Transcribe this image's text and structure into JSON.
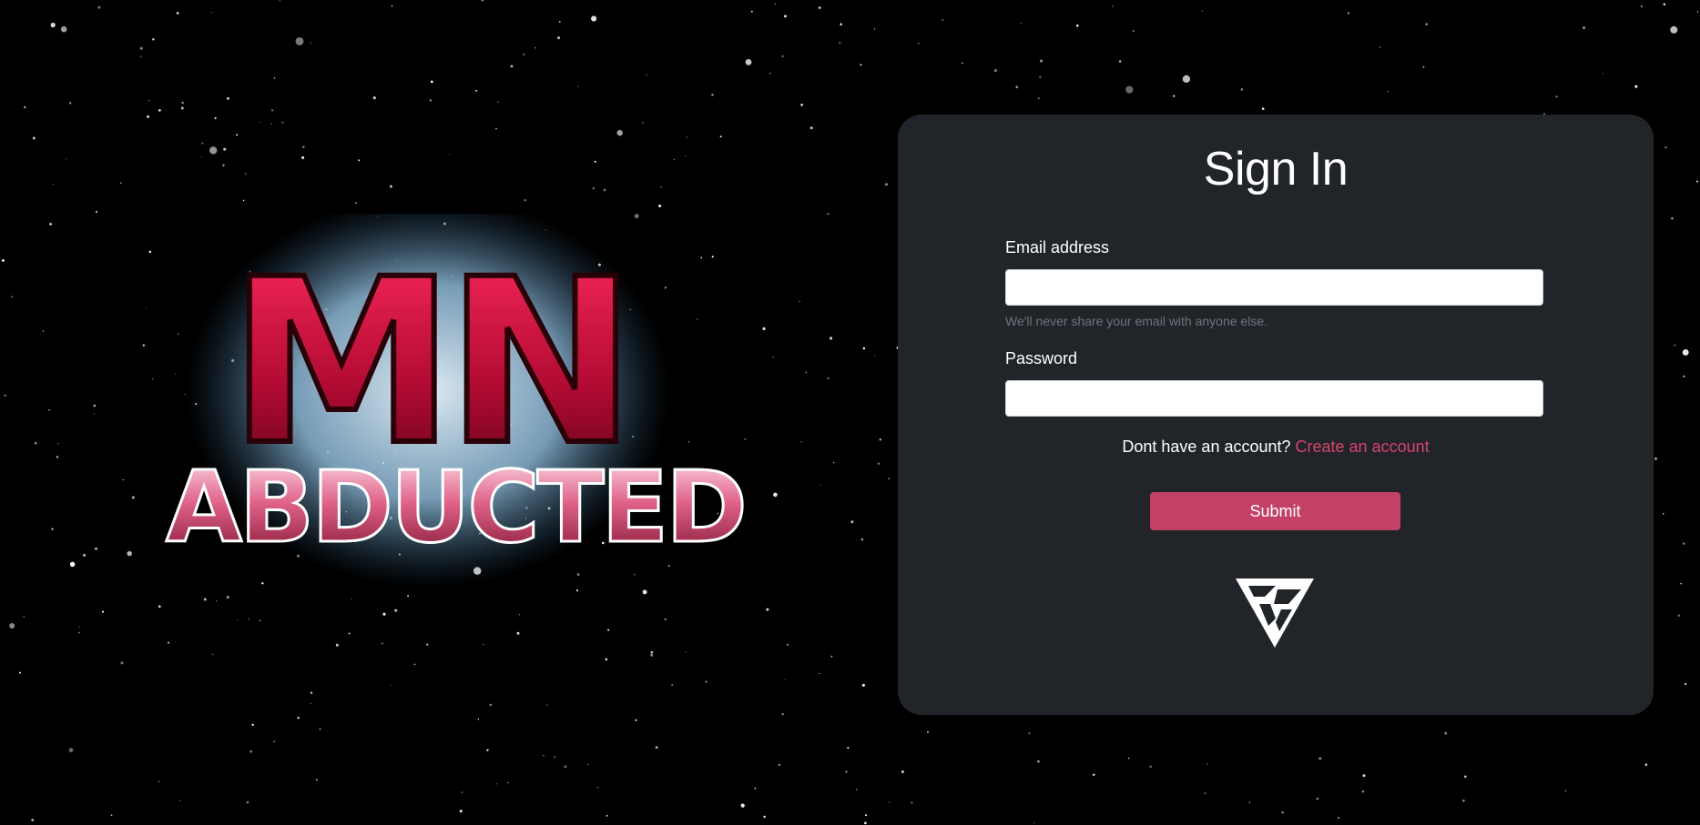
{
  "logo": {
    "line1": "MN",
    "line2": "ABDUCTED"
  },
  "signin": {
    "title": "Sign In",
    "email_label": "Email address",
    "email_value": "",
    "email_help": "We'll never share your email with anyone else.",
    "password_label": "Password",
    "password_value": "",
    "no_account_text": "Dont have an account?",
    "create_link": "Create an account",
    "submit_label": "Submit"
  },
  "colors": {
    "background": "#000000",
    "card": "#212529",
    "accent": "#c44166",
    "link": "#d8446d",
    "logo_red": "#c8103c",
    "logo_glow": "#bfe3ff"
  },
  "icons": {
    "brand": "triangle-brand-icon"
  }
}
